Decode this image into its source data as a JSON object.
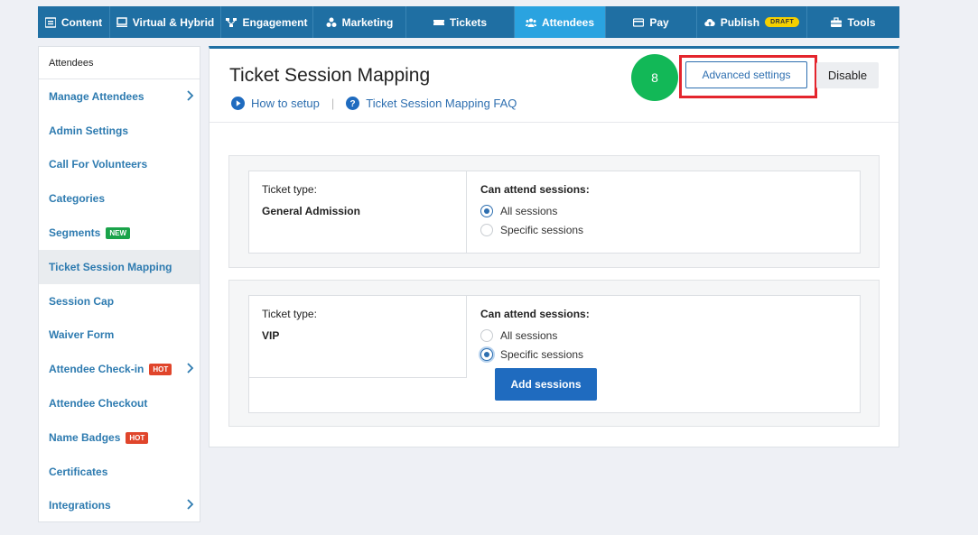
{
  "nav": {
    "items": [
      {
        "label": "Content",
        "icon": "content-icon"
      },
      {
        "label": "Virtual & Hybrid",
        "icon": "monitor-icon"
      },
      {
        "label": "Engagement",
        "icon": "engagement-icon"
      },
      {
        "label": "Marketing",
        "icon": "marketing-icon"
      },
      {
        "label": "Tickets",
        "icon": "ticket-icon"
      },
      {
        "label": "Attendees",
        "icon": "attendees-icon",
        "active": true
      },
      {
        "label": "Pay",
        "icon": "card-icon"
      },
      {
        "label": "Publish",
        "icon": "cloud-upload-icon",
        "badge": "DRAFT"
      },
      {
        "label": "Tools",
        "icon": "toolbox-icon"
      }
    ]
  },
  "sidebar": {
    "header": "Attendees",
    "items": [
      {
        "label": "Manage Attendees",
        "chevron": true
      },
      {
        "label": "Admin Settings"
      },
      {
        "label": "Call For Volunteers"
      },
      {
        "label": "Categories"
      },
      {
        "label": "Segments",
        "badge": "NEW"
      },
      {
        "label": "Ticket Session Mapping",
        "active": true
      },
      {
        "label": "Session Cap"
      },
      {
        "label": "Waiver Form"
      },
      {
        "label": "Attendee Check-in",
        "badge": "HOT",
        "chevron": true
      },
      {
        "label": "Attendee Checkout"
      },
      {
        "label": "Name Badges",
        "badge": "HOT"
      },
      {
        "label": "Certificates"
      },
      {
        "label": "Integrations",
        "chevron": true
      }
    ]
  },
  "main": {
    "title": "Ticket Session Mapping",
    "how_to_setup": "How to setup",
    "separator": "|",
    "faq": "Ticket Session Mapping FAQ",
    "step_number": "8",
    "advanced_settings": "Advanced settings",
    "disable": "Disable",
    "tickets": [
      {
        "type_label": "Ticket type:",
        "type_value": "General Admission",
        "attend_title": "Can attend sessions:",
        "option_all": "All sessions",
        "option_specific": "Specific sessions",
        "selected": "all"
      },
      {
        "type_label": "Ticket type:",
        "type_value": "VIP",
        "attend_title": "Can attend sessions:",
        "option_all": "All sessions",
        "option_specific": "Specific sessions",
        "selected": "specific",
        "add_sessions": "Add sessions"
      }
    ]
  },
  "colors": {
    "nav_bg": "#1f6fa3",
    "nav_active": "#2aa3e0",
    "link": "#2e7bb0",
    "step_green": "#12b857",
    "highlight_red": "#e4252d",
    "primary_button": "#1f6bbf"
  }
}
